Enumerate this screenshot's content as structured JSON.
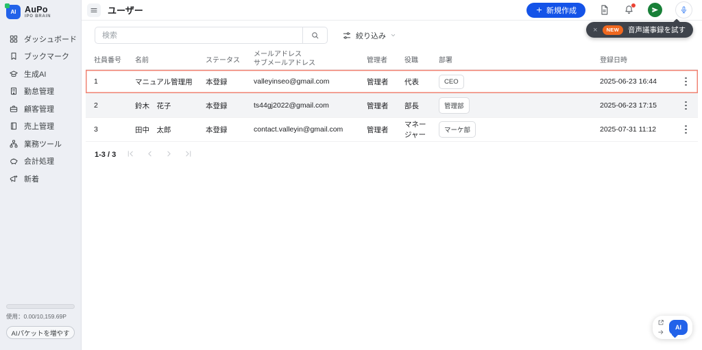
{
  "brand": {
    "name": "AuPo",
    "subtitle": "IPO BRAIN",
    "bubble_text": "AI"
  },
  "sidebar": {
    "items": [
      {
        "label": "ダッシュボード",
        "icon": "dashboard-icon"
      },
      {
        "label": "ブックマーク",
        "icon": "bookmark-icon"
      },
      {
        "label": "生成AI",
        "icon": "generative-ai-icon"
      },
      {
        "label": "勤怠管理",
        "icon": "attendance-icon"
      },
      {
        "label": "顧客管理",
        "icon": "customer-icon"
      },
      {
        "label": "売上管理",
        "icon": "sales-icon"
      },
      {
        "label": "業務ツール",
        "icon": "business-tools-icon"
      },
      {
        "label": "会計処理",
        "icon": "accounting-icon"
      },
      {
        "label": "新着",
        "icon": "whats-new-icon"
      }
    ],
    "usage_text": "使用：0.00/10,159.69P",
    "usage_percent": 0,
    "add_packets_label": "AIパケットを増やす"
  },
  "header": {
    "title": "ユーザー",
    "create_label": "新規作成"
  },
  "tooltip": {
    "close": "×",
    "badge": "NEW",
    "text": "音声議事録を試す"
  },
  "toolbar": {
    "search_placeholder": "検索",
    "filter_label": "絞り込み"
  },
  "table": {
    "columns": {
      "employee_no": "社員番号",
      "name": "名前",
      "status": "ステータス",
      "email_line1": "メールアドレス",
      "email_line2": "サブメールアドレス",
      "admin": "管理者",
      "position": "役職",
      "department": "部署",
      "registered": "登録日時"
    },
    "rows": [
      {
        "employee_no": "1",
        "name": "マニュアル管理用",
        "status": "本登録",
        "email": "valleyinseo@gmail.com",
        "admin": "管理者",
        "position": "代表",
        "department": "CEO",
        "registered": "2025-06-23 16:44",
        "highlighted": true
      },
      {
        "employee_no": "2",
        "name": "鈴木　花子",
        "status": "本登録",
        "email": "ts44gj2022@gmail.com",
        "admin": "管理者",
        "position": "部長",
        "department": "管理部",
        "registered": "2025-06-23 17:15",
        "highlighted": false
      },
      {
        "employee_no": "3",
        "name": "田中　太郎",
        "status": "本登録",
        "email": "contact.valleyin@gmail.com",
        "admin": "管理者",
        "position": "マネージャー",
        "department": "マーケ部",
        "registered": "2025-07-31 11:12",
        "highlighted": false
      }
    ]
  },
  "pagination": {
    "label": "1-3 / 3"
  },
  "widget": {
    "ai_text": "AI"
  },
  "colors": {
    "accent_blue": "#1453e8",
    "sidebar_bg": "#edeff4",
    "highlight_red": "#f08373",
    "badge_orange": "#f0681f",
    "avatar_green": "#188038",
    "mic_blue": "#4285f4",
    "notification_red": "#ea4335"
  }
}
